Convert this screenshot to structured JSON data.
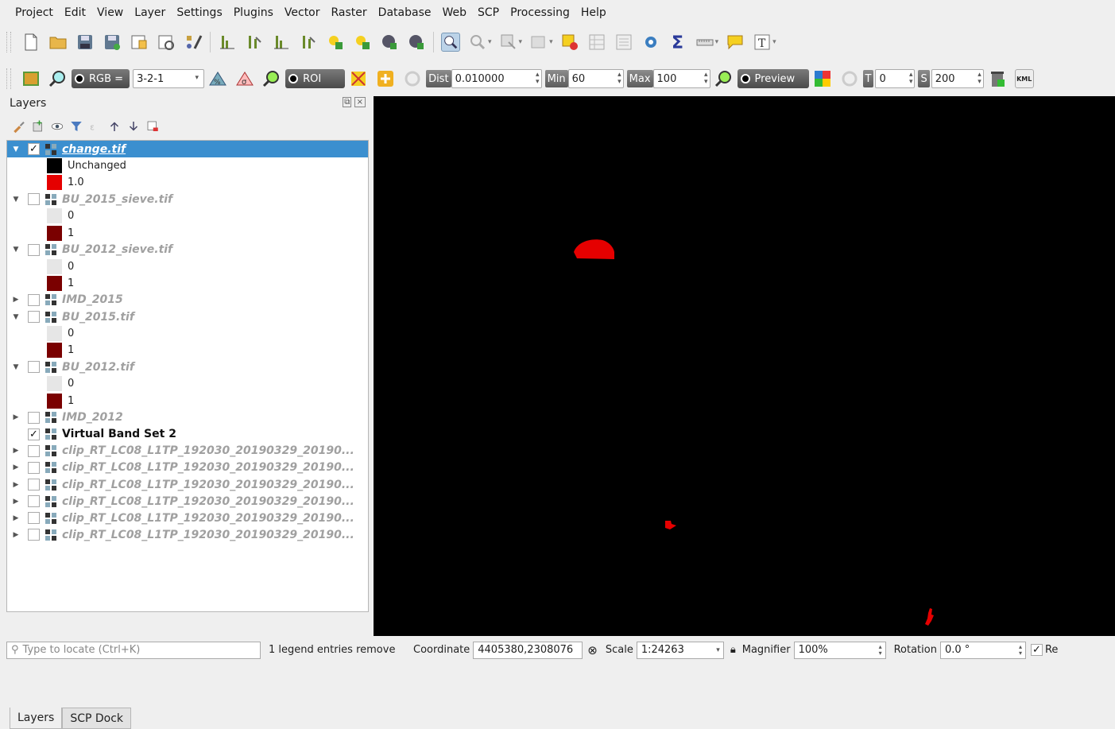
{
  "menu": [
    "Project",
    "Edit",
    "View",
    "Layer",
    "Settings",
    "Plugins",
    "Vector",
    "Raster",
    "Database",
    "Web",
    "SCP",
    "Processing",
    "Help"
  ],
  "toolbar1": {
    "icons": [
      "new-project-icon",
      "open-project-icon",
      "save-project-icon",
      "save-as-icon",
      "new-print-layout-icon",
      "layout-manager-icon",
      "style-manager-icon",
      "histogram-icon",
      "histogram-node-icon",
      "histogram-2-icon",
      "histogram-node-2-icon",
      "add-feature-icon",
      "add-feature-2-icon",
      "digitize-icon",
      "digitize-2-icon",
      "identify-icon",
      "select-radius-icon",
      "select-features-icon",
      "deselect-icon",
      "clear-selection-icon",
      "attribute-table-icon",
      "field-calculator-icon",
      "processing-toolbox-icon",
      "statistics-icon",
      "measure-icon",
      "map-tips-icon",
      "text-annotation-icon"
    ]
  },
  "toolbar2": {
    "rgb_label": "RGB =",
    "rgb_value": "3-2-1",
    "roi_label": "ROI",
    "dist_label": "Dist",
    "dist_value": "0.010000",
    "min_label": "Min",
    "min_value": "60",
    "max_label": "Max",
    "max_value": "100",
    "preview_label": "Preview",
    "t_label": "T",
    "t_value": "0",
    "s_label": "S",
    "s_value": "200",
    "kml_label": "KML"
  },
  "layers_panel": {
    "title": "Layers",
    "tabs": [
      "Layers",
      "SCP Dock"
    ]
  },
  "layers": [
    {
      "name": "change.tif",
      "checked": true,
      "expanded": true,
      "selected": true,
      "legend": [
        {
          "label": "Unchanged",
          "color": "#000000"
        },
        {
          "label": "1.0",
          "color": "#e50000"
        }
      ]
    },
    {
      "name": "BU_2015_sieve.tif",
      "checked": false,
      "expanded": true,
      "legend": [
        {
          "label": "0",
          "color": "#e6e6e6"
        },
        {
          "label": "1",
          "color": "#7a0000"
        }
      ]
    },
    {
      "name": "BU_2012_sieve.tif",
      "checked": false,
      "expanded": true,
      "legend": [
        {
          "label": "0",
          "color": "#e6e6e6"
        },
        {
          "label": "1",
          "color": "#7a0000"
        }
      ]
    },
    {
      "name": "IMD_2015",
      "checked": false,
      "expanded": false
    },
    {
      "name": "BU_2015.tif",
      "checked": false,
      "expanded": true,
      "legend": [
        {
          "label": "0",
          "color": "#e6e6e6"
        },
        {
          "label": "1",
          "color": "#7a0000"
        }
      ]
    },
    {
      "name": "BU_2012.tif",
      "checked": false,
      "expanded": true,
      "legend": [
        {
          "label": "0",
          "color": "#e6e6e6"
        },
        {
          "label": "1",
          "color": "#7a0000"
        }
      ]
    },
    {
      "name": "IMD_2012",
      "checked": false,
      "expanded": false
    },
    {
      "name": "Virtual Band Set 2",
      "checked": true,
      "expanded": null,
      "bold": true
    },
    {
      "name": "clip_RT_LC08_L1TP_192030_20190329_20190...",
      "checked": false,
      "expanded": false
    },
    {
      "name": "clip_RT_LC08_L1TP_192030_20190329_20190...",
      "checked": false,
      "expanded": false
    },
    {
      "name": "clip_RT_LC08_L1TP_192030_20190329_20190...",
      "checked": false,
      "expanded": false
    },
    {
      "name": "clip_RT_LC08_L1TP_192030_20190329_20190...",
      "checked": false,
      "expanded": false
    },
    {
      "name": "clip_RT_LC08_L1TP_192030_20190329_20190...",
      "checked": false,
      "expanded": false
    },
    {
      "name": "clip_RT_LC08_L1TP_192030_20190329_20190...",
      "checked": false,
      "expanded": false
    }
  ],
  "map": {
    "background": "#000000",
    "feature_color": "#e50000"
  },
  "statusbar": {
    "locate_placeholder": "Type to locate (Ctrl+K)",
    "message": "1 legend entries remove",
    "coordinate_label": "Coordinate",
    "coordinate_value": "4405380,2308076",
    "scale_label": "Scale",
    "scale_value": "1:24263",
    "magnifier_label": "Magnifier",
    "magnifier_value": "100%",
    "rotation_label": "Rotation",
    "rotation_value": "0.0 °",
    "render_label": "Re"
  }
}
